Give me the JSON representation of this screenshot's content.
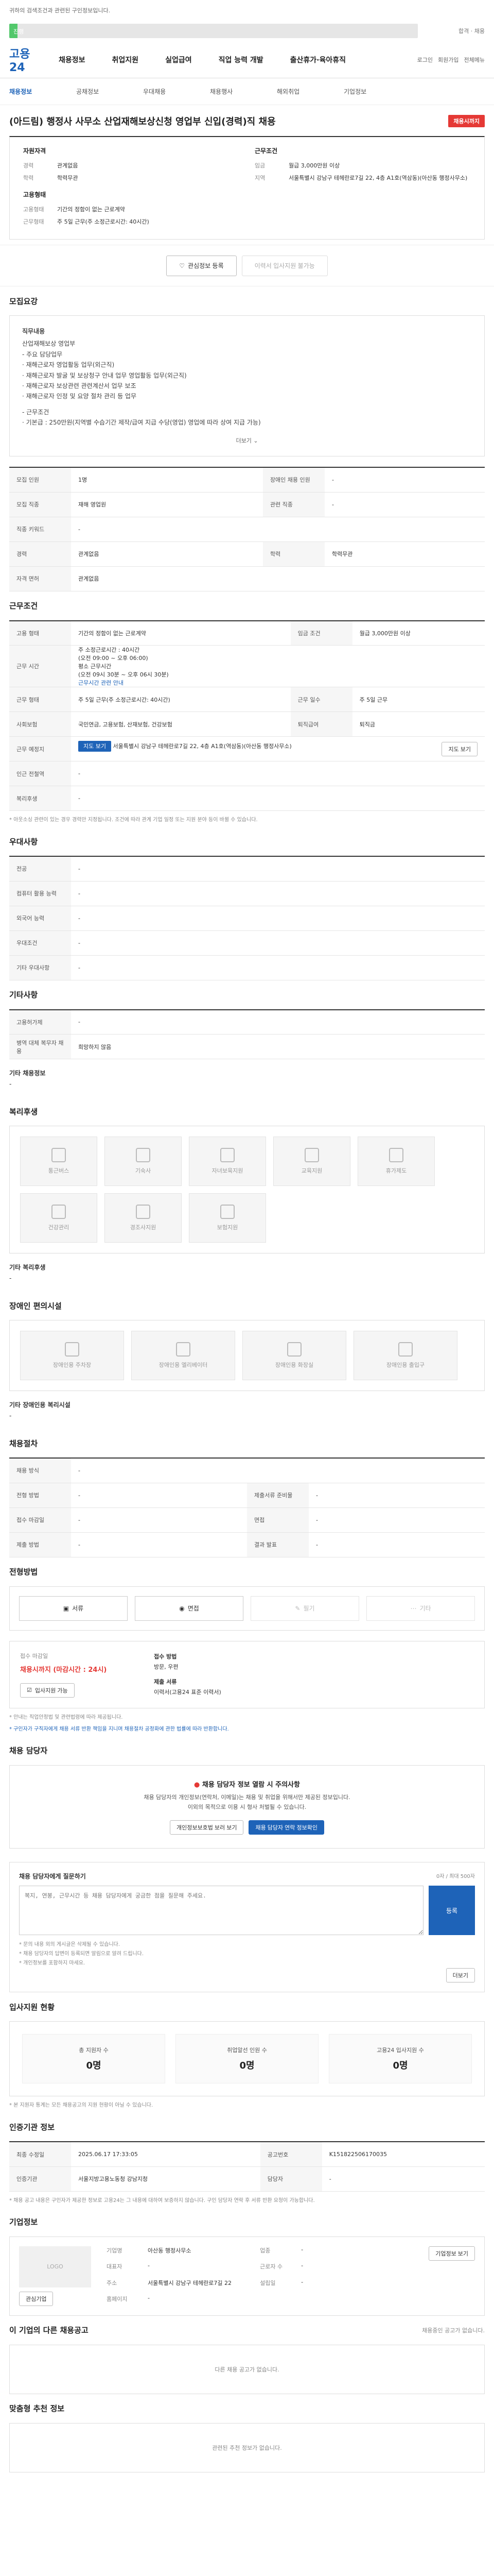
{
  "top": {
    "note": "귀하의 검색조건과 관련된 구인정보입니다.",
    "progress_label": "진행",
    "progress_value": 0.02,
    "progress_right": "합격 · 채용"
  },
  "gnb": {
    "logo": "고용24",
    "menu": [
      "채용정보",
      "취업지원",
      "실업급여",
      "직업 능력 개발",
      "출산휴가·육아휴직"
    ],
    "tools": [
      "로그인",
      "회원가입",
      "전체메뉴"
    ]
  },
  "lnb": {
    "items": [
      "채용정보",
      "공채정보",
      "우대채용",
      "채용행사",
      "해외취업",
      "기업정보"
    ],
    "active": 0
  },
  "job": {
    "title": "(아드림) 행정사 사무소 산업재해보상신청 영업부 신입(경력)직 채용",
    "badge": "채용시까지",
    "summary_left_title": "자원자격",
    "summary_left": [
      {
        "k": "경력",
        "v": "관계없음"
      },
      {
        "k": "학력",
        "v": "학력무관"
      }
    ],
    "summary_left_title2": "고용형태",
    "summary_left2": [
      {
        "k": "고용형태",
        "v": "기간의 정함이 없는 근로계약"
      },
      {
        "k": "근무형태",
        "v": "주 5일 근무(주 소정근로시간: 40시간)"
      }
    ],
    "summary_right_title": "근무조건",
    "summary_right": [
      {
        "k": "임금",
        "v": "월급 3,000만원 이상"
      },
      {
        "k": "지역",
        "v": "서울특별시 강남구 테헤란로7길 22, 4층 A1호(역삼동)(아산동 행정사무소)"
      }
    ]
  },
  "actions": {
    "interest": "관심정보 등록",
    "apply_disabled": "이력서 입사지원 불가능"
  },
  "recruit": {
    "title": "모집요강",
    "desc_title": "직무내용",
    "desc_lines": [
      "산업재해보상 영업부",
      "- 주요 담당업무",
      "· 재해근로자 영업활동 업무(외근직)",
      "· 재해근로자 발굴 및 보상청구 안내 업무 영업활동 업무(외근직)",
      "· 재해근로자 보상관련 관련계산서 업무 보조",
      "· 재해근로자 인정 및 요양 절차 관리 등 업무",
      "- 근무조건",
      "· 기본급 : 250만원(지역별 수습기간 제작/급여 지급 수당(영업) 영업에 따라 상여 지급 가능)"
    ],
    "more": "더보기",
    "rows": [
      {
        "k": "모집 인원",
        "v": "1명",
        "k2": "장애인 채용 인원",
        "v2": "-"
      },
      {
        "k": "모집 직종",
        "v": "재해 영업원",
        "k2": "관련 직종",
        "v2": "-"
      },
      {
        "k": "직종 키워드",
        "v": "-",
        "k2": "",
        "v2": ""
      },
      {
        "k": "경력",
        "v": "관계없음",
        "k2": "학력",
        "v2": "학력무관"
      },
      {
        "k": "자격 면허",
        "v": "관계없음",
        "k2": "",
        "v2": ""
      }
    ]
  },
  "condition": {
    "title": "근무조건",
    "employment": "기간의 정함이 없는 근로계약",
    "wage_label": "임금 조건",
    "wage": "월급 3,000만원 이상",
    "time_label": "근무 시간",
    "time_lines": [
      "주 소정근로시간 : 40시간",
      "(오전 09:00 ~ 오후 06:00)",
      "평소 근무시간",
      "(오전 09시 30분 ~ 오후 06시 30분)"
    ],
    "time_link": "근무시간 관련 안내",
    "week_label": "근무 형태",
    "week": "주 5일 근무(주 소정근로시간: 40시간)",
    "days_label": "근무 예정지",
    "days": "주 5일 근무",
    "social_label": "사회보험",
    "social": "국민연금, 고용보험, 산재보험, 건강보험",
    "retire_label": "퇴직급여",
    "retire": "퇴직금",
    "addr_label": "근무 예정지",
    "addr_badge": "지도 보기",
    "addr": "서울특별시 강남구 테헤란로7길 22, 4층 A1호(역삼동)(아산동 행정사무소)",
    "addr_more": "지도 보기",
    "station_label": "인근 전철역",
    "station": "-",
    "nearby_label": "복리후생",
    "nearby": "-",
    "note": "* 아웃소싱 관련이 있는 경우 경력만 지정됩니다. 조건에 따라 관계 기업 일정 또는 지원 분야 등이 바뀔 수 있습니다."
  },
  "preference": {
    "title": "우대사항",
    "rows": [
      {
        "k": "전공",
        "v": "-"
      },
      {
        "k": "컴퓨터 활용 능력",
        "v": "-"
      },
      {
        "k": "외국어 능력",
        "v": "-"
      },
      {
        "k": "우대조건",
        "v": "-"
      },
      {
        "k": "기타 우대사항",
        "v": "-"
      }
    ]
  },
  "etc": {
    "title": "기타사항",
    "rows": [
      {
        "k": "고용허가제",
        "v": "-"
      },
      {
        "k": "병역 대체 복무자 채용",
        "v": "희망하지 않음"
      }
    ],
    "extra_title": "기타 채용정보",
    "extra": "-"
  },
  "welfare": {
    "title": "복리후생",
    "items": [
      "통근버스",
      "기숙사",
      "자녀보육지원",
      "교육지원",
      "휴가제도",
      "건강관리",
      "경조사지원",
      "보험지원"
    ],
    "extra_title": "기타 복리후생",
    "extra": "-"
  },
  "disability": {
    "title": "장애인 편의시설",
    "items": [
      "장애인용 주차장",
      "장애인용 엘리베이터",
      "장애인용 화장실",
      "장애인용 출입구"
    ],
    "extra_title": "기타 장애인용 복리시설",
    "extra": "-"
  },
  "process": {
    "title": "채용절차",
    "rows": [
      {
        "k": "채용 방식",
        "v": "-",
        "k2": "",
        "v2": ""
      },
      {
        "k": "전형 방법",
        "v": "-",
        "k2": "제출서류 준비물",
        "v2": "-"
      },
      {
        "k": "접수 마감일",
        "v": "-",
        "k2": "면접",
        "v2": "-"
      },
      {
        "k": "제출 방법",
        "v": "-",
        "k2": "결과 발표",
        "v2": "-"
      }
    ]
  },
  "method": {
    "title": "전형방법",
    "items": [
      {
        "label": "서류",
        "on": true
      },
      {
        "label": "면접",
        "on": true
      },
      {
        "label": "필기",
        "on": false
      },
      {
        "label": "기타",
        "on": false
      }
    ]
  },
  "apply": {
    "deadline_label": "접수 마감일",
    "deadline": "채용시까지 (마감시간 : 24시)",
    "method_label": "접수 방법",
    "method": "방문, 우편",
    "doc_label": "제출 서류",
    "doc": "이력서(고용24 표준 이력서)",
    "apply_btn": "입사지원 가능",
    "notes": [
      "* 안내는 직업안정법 및 관련법령에 따라 제공됩니다.",
      "* 구인자가 구직자에게 채용 서류 반환 책임을 지니며 채용절차 공정화에 관한 법률에 따라 반환합니다."
    ]
  },
  "contact": {
    "title": "채용 담당자",
    "alert_title": "채용 담당자 정보 열람 시 주의사항",
    "alert_lines": [
      "채용 담당자의 개인정보(연락처, 이메일)는 채용 및 취업을 위해서만 제공된 정보입니다.",
      "이외의 목적으로 이용 시 형사 처벌될 수 있습니다."
    ],
    "btn1": "개인정보보호법 보러 보기",
    "btn2": "채용 담당자 연락 정보확인"
  },
  "qa": {
    "title": "채용 담당자에게 질문하기",
    "limit": "0자 / 최대 500자",
    "placeholder": "복지, 연봉, 근무시간 등 채용 담당자에게 궁금한 점을 질문해 주세요.",
    "submit": "등록",
    "notes": [
      "* 문의 내용 외의 게시글은 삭제될 수 있습니다.",
      "* 채용 담당자의 답변이 등록되면 알림으로 알려 드립니다.",
      "* 개인정보를 포함하지 마세요."
    ],
    "more": "더보기"
  },
  "status": {
    "title": "입사지원 현황",
    "items": [
      {
        "label": "총 지원자 수",
        "value": "0명"
      },
      {
        "label": "취업알선 인원 수",
        "value": "0명"
      },
      {
        "label": "고용24 입사지원 수",
        "value": "0명"
      }
    ],
    "note": "* 본 지원자 통계는 모든 채용공고의 지원 현황이 아닐 수 있습니다."
  },
  "meta": {
    "title": "인증기관 정보",
    "rows": [
      {
        "k": "최종 수정일",
        "v": "2025.06.17 17:33:05",
        "k2": "공고번호",
        "v2": "K151822506170035"
      },
      {
        "k": "인증기관",
        "v": "서울지방고용노동청 강남지청",
        "k2": "담당자",
        "v2": "-"
      }
    ],
    "note": "* 채용 공고 내용은 구인자가 제공한 정보로 고용24는 그 내용에 대하여 보증하지 않습니다. 구인 담당자 연락 후 서류 반환 요청이 가능합니다."
  },
  "company": {
    "title": "기업정보",
    "logo": "LOGO",
    "btn_interest": "관심기업",
    "btn_more": "기업정보 보기",
    "rows": [
      {
        "k": "기업명",
        "v": "아산동 행정사무소",
        "k2": "업종",
        "v2": "-"
      },
      {
        "k": "대표자",
        "v": "-",
        "k2": "근로자 수",
        "v2": "-"
      },
      {
        "k": "주소",
        "v": "서울특별시 강남구 테헤란로7길 22",
        "k2": "설립일",
        "v2": "-"
      },
      {
        "k": "홈페이지",
        "v": "-",
        "k2": "",
        "v2": ""
      }
    ],
    "more_btn": "기업정보 더보기"
  },
  "other_jobs": {
    "title": "이 기업의 다른 채용공고",
    "sub": "채용중인 공고가 없습니다.",
    "empty": "다른 채용 공고가 없습니다."
  },
  "recommend": {
    "title": "맞춤형 추천 정보",
    "empty": "관련된 추천 정보가 없습니다."
  }
}
